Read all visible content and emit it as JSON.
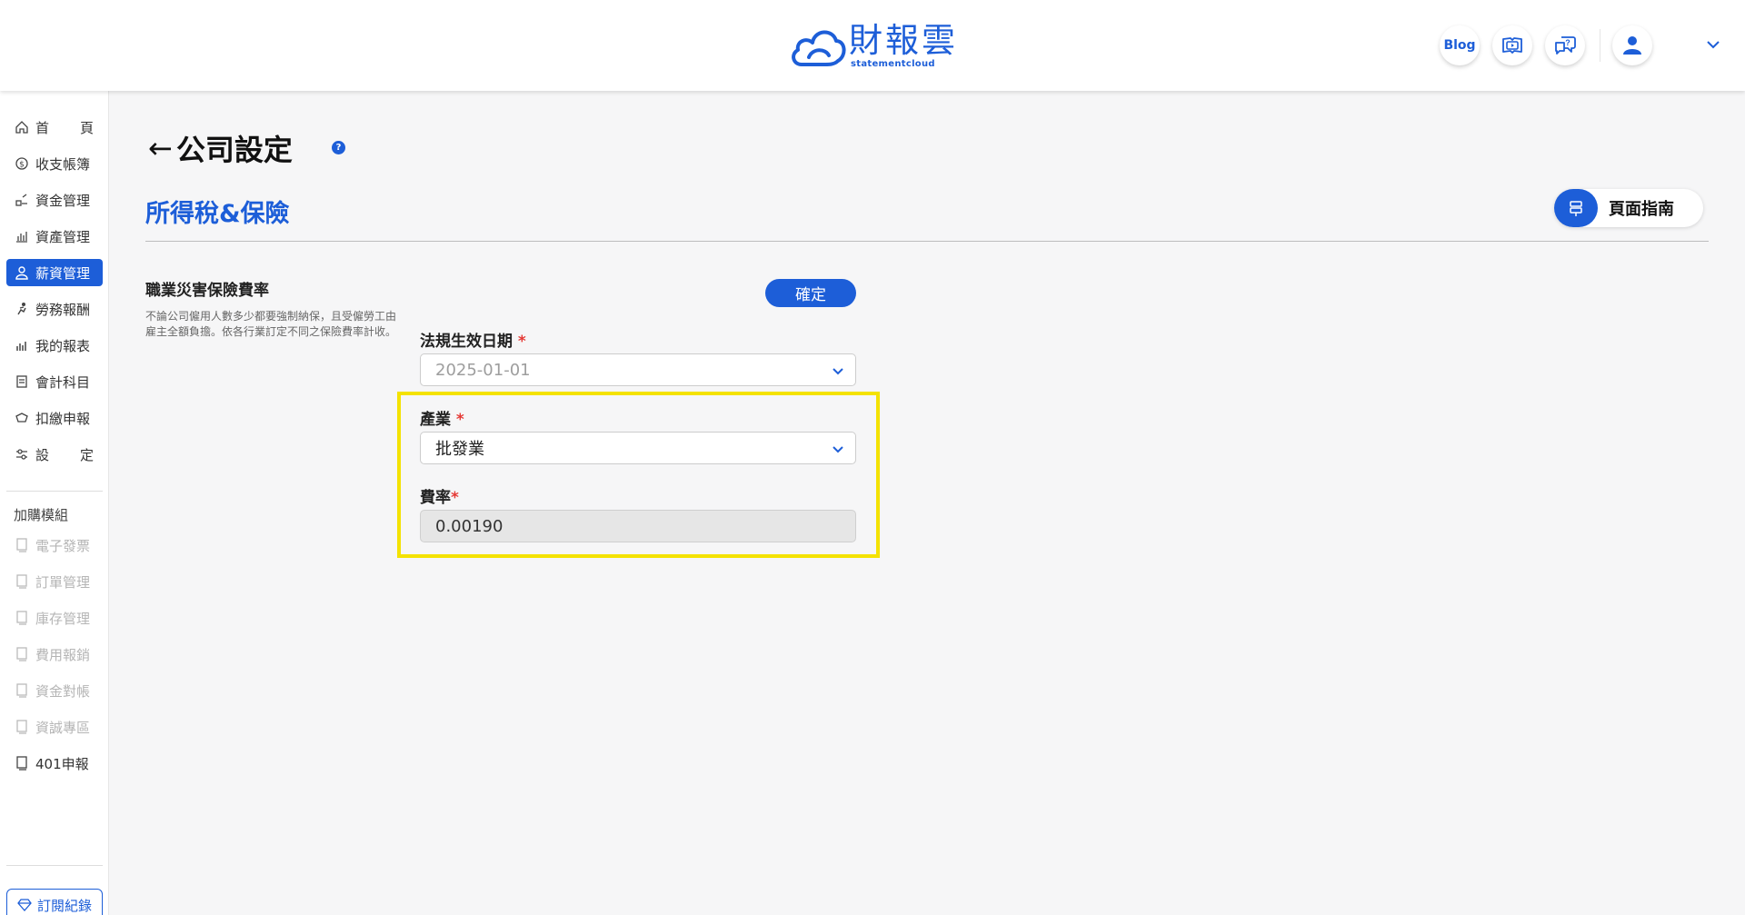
{
  "header": {
    "logo_title": "財報雲",
    "logo_subtitle": "statementcloud",
    "blog_label": "Blog"
  },
  "sidebar": {
    "items": [
      {
        "label_a": "首",
        "label_b": "頁",
        "icon": "home-icon"
      },
      {
        "label": "收支帳簿",
        "icon": "coin-icon"
      },
      {
        "label": "資金管理",
        "icon": "fund-icon"
      },
      {
        "label": "資產管理",
        "icon": "bar-chart-icon"
      },
      {
        "label": "薪資管理",
        "icon": "payroll-icon",
        "active": true
      },
      {
        "label": "勞務報酬",
        "icon": "labor-icon"
      },
      {
        "label": "我的報表",
        "icon": "report-icon"
      },
      {
        "label": "會計科目",
        "icon": "ledger-icon"
      },
      {
        "label": "扣繳申報",
        "icon": "tax-icon"
      },
      {
        "label_a": "設",
        "label_b": "定",
        "icon": "settings-icon"
      }
    ],
    "addon_heading": "加購模組",
    "addons": [
      {
        "label": "電子發票",
        "icon": "addon-icon",
        "disabled": true
      },
      {
        "label": "訂單管理",
        "icon": "addon-icon",
        "disabled": true
      },
      {
        "label": "庫存管理",
        "icon": "addon-icon",
        "disabled": true
      },
      {
        "label": "費用報銷",
        "icon": "addon-icon",
        "disabled": true
      },
      {
        "label": "資金對帳",
        "icon": "addon-icon",
        "disabled": true
      },
      {
        "label": "資誠專區",
        "icon": "addon-icon",
        "disabled": true
      },
      {
        "label": "401申報",
        "icon": "addon-icon",
        "disabled": false
      }
    ],
    "subscription_label": "訂閱紀錄"
  },
  "main": {
    "page_title": "公司設定",
    "help_mark": "?",
    "section_title": "所得稅&保險",
    "guide_label": "頁面指南",
    "block_title": "職業災害保險費率",
    "block_desc": "不論公司僱用人數多少都要強制納保，且受僱勞工由雇主全額負擔。依各行業訂定不同之保險費率計收。",
    "confirm_label": "確定",
    "effective_date": {
      "label": "法規生效日期",
      "required_mark": "*",
      "value": "2025-01-01"
    },
    "industry": {
      "label": "產業",
      "required_mark": "*",
      "value": "批發業"
    },
    "rate": {
      "label": "費率",
      "required_mark": "*",
      "value": "0.00190"
    }
  },
  "colors": {
    "brand": "#1d5ed8",
    "highlight": "#f4e200",
    "required": "#e53935"
  }
}
